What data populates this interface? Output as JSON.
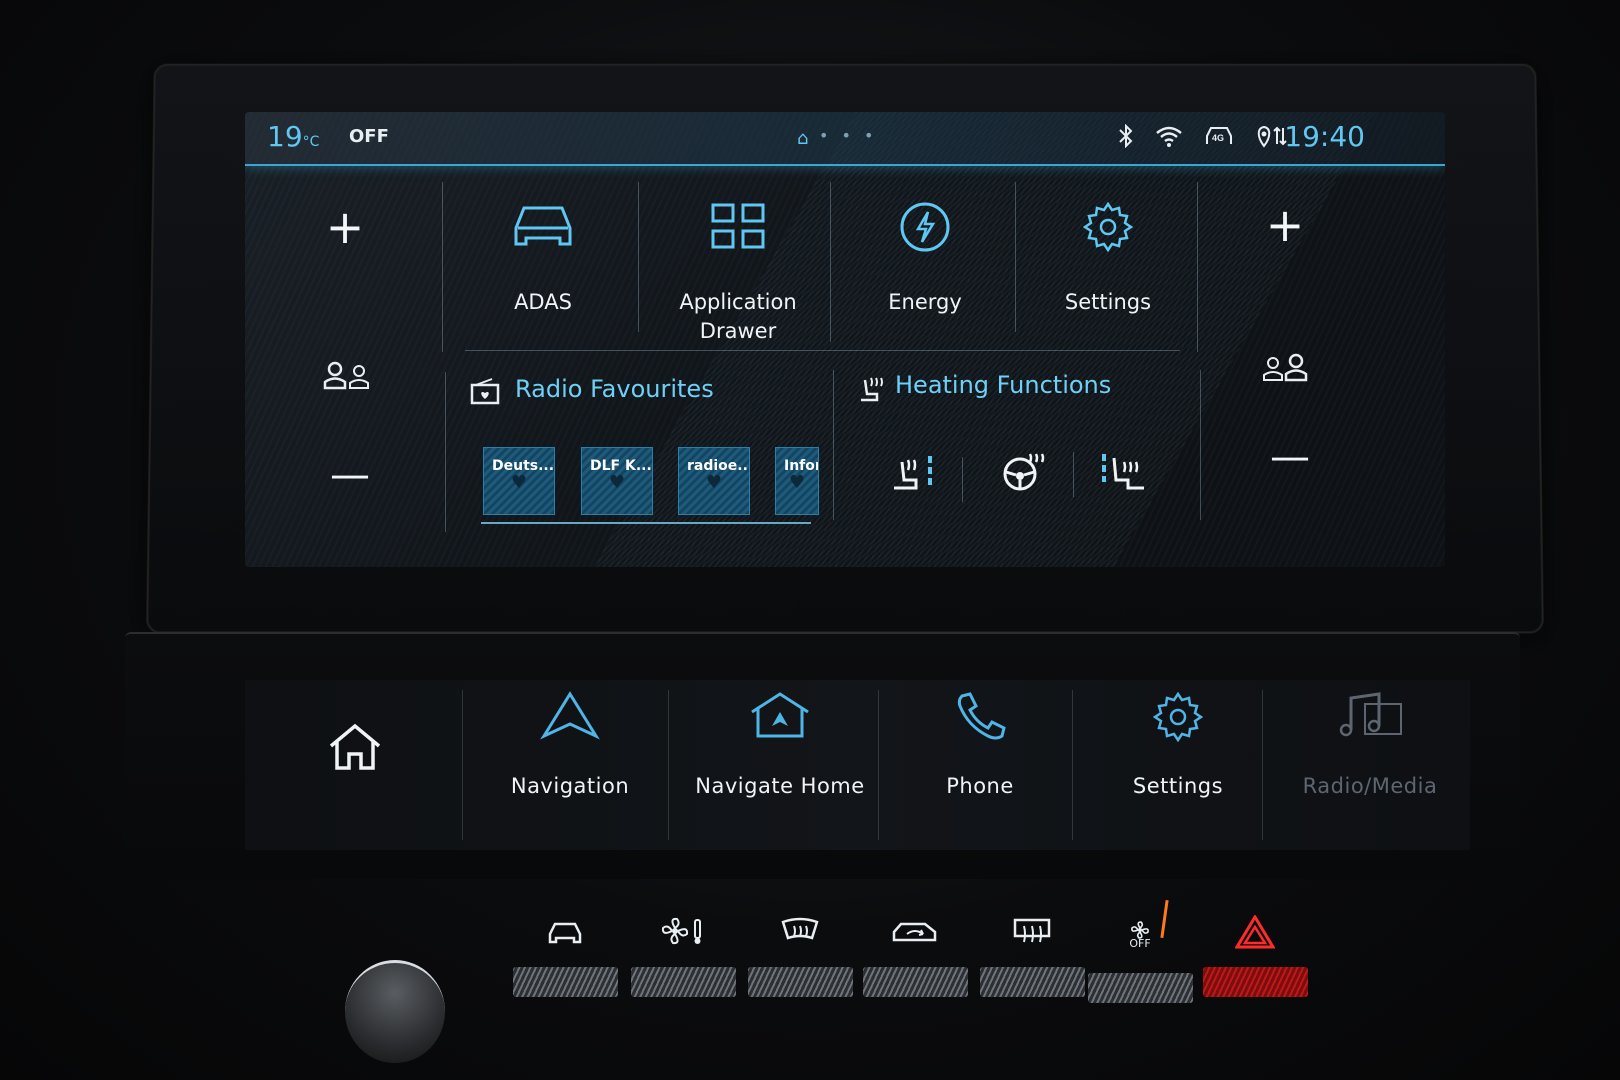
{
  "status_bar": {
    "temperature": "19",
    "temperature_unit": "°C",
    "ac_state": "OFF",
    "page_dots": "• • •",
    "time": "19:40",
    "icons": [
      "bluetooth-icon",
      "wifi-icon",
      "4g-icon",
      "location-icon"
    ]
  },
  "left_zone": {
    "plus_label": "+",
    "minus_label": "—",
    "profile_icon": "driver-profile-icon"
  },
  "right_zone": {
    "plus_label": "+",
    "minus_label": "—",
    "profile_icon": "passenger-profile-icon"
  },
  "tiles": [
    {
      "label": "ADAS",
      "icon": "car-front-icon"
    },
    {
      "label": "Application\nDrawer",
      "icon": "app-grid-icon"
    },
    {
      "label": "Energy",
      "icon": "lightning-icon"
    },
    {
      "label": "Settings",
      "icon": "gear-icon"
    }
  ],
  "radio_favourites": {
    "title": "Radio Favourites",
    "stations": [
      "Deuts...",
      "DLF K...",
      "radioe...",
      "Infora"
    ]
  },
  "heating_functions": {
    "title": "Heating Functions",
    "items": [
      "seat-heat-icon",
      "steering-wheel-heat-icon",
      "rear-seat-heat-icon"
    ]
  },
  "bottom_bar": [
    {
      "label": "",
      "icon": "home-icon"
    },
    {
      "label": "Navigation",
      "icon": "navigation-arrow-icon"
    },
    {
      "label": "Navigate Home",
      "icon": "navigate-home-icon"
    },
    {
      "label": "Phone",
      "icon": "phone-icon"
    },
    {
      "label": "Settings",
      "icon": "gear-icon"
    },
    {
      "label": "Radio/Media",
      "icon": "music-note-icon"
    }
  ],
  "hvac_controls": {
    "recirc_off_label": "OFF",
    "buttons": [
      "car-icon",
      "fan-temp-icon",
      "windshield-defrost-icon",
      "recirculation-icon",
      "rear-defrost-icon",
      "fan-off-icon",
      "hazard-icon"
    ]
  },
  "colors": {
    "accent": "#5fc7f2",
    "hazard": "#ff2b2b"
  }
}
